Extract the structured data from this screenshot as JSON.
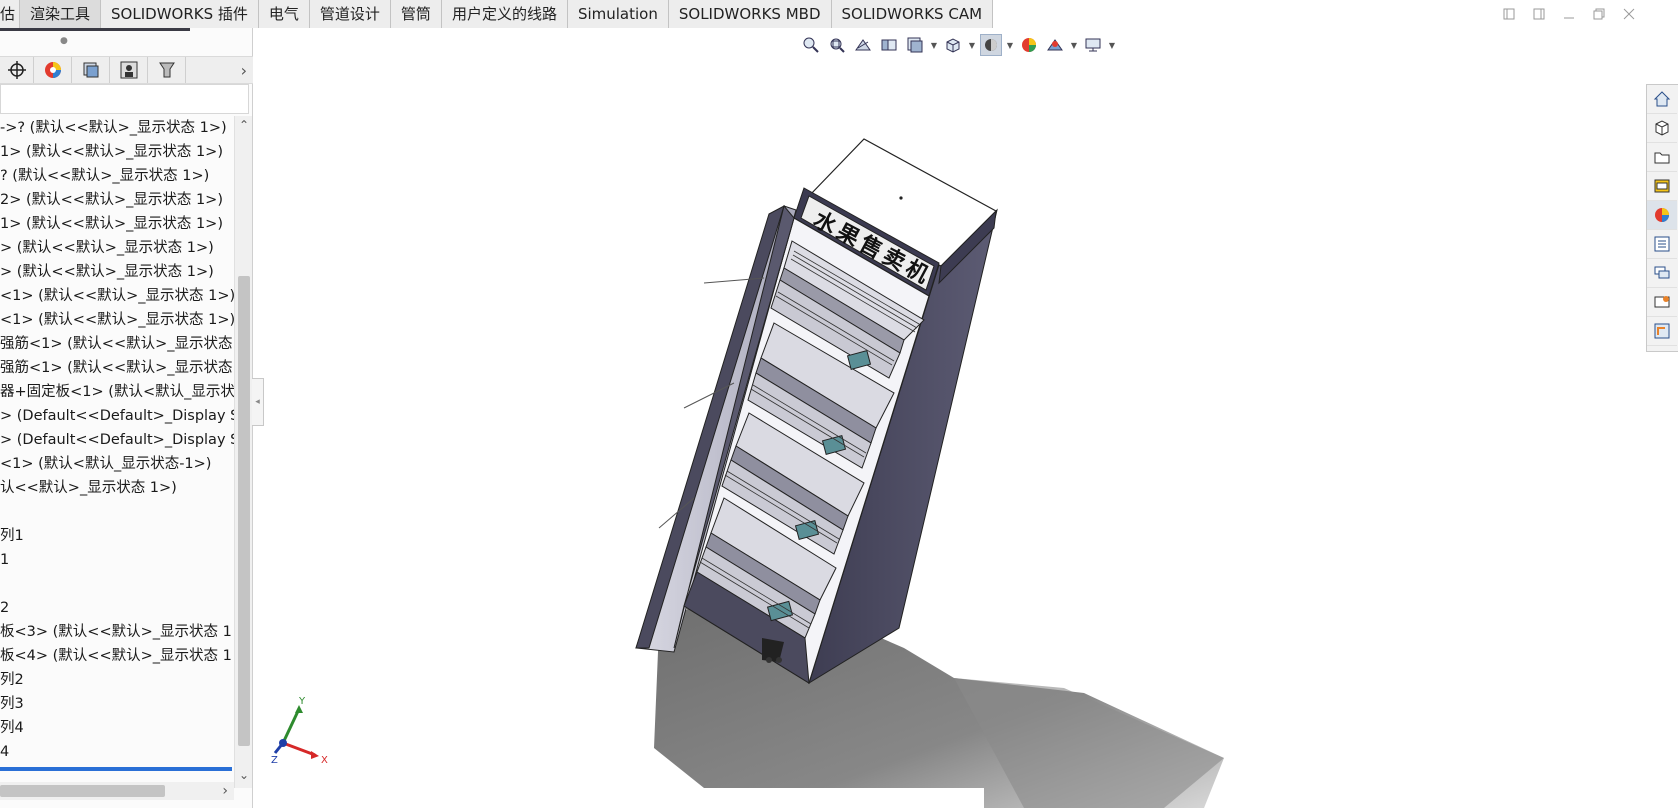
{
  "tabs": [
    {
      "label": "估",
      "active": false
    },
    {
      "label": "渲染工具",
      "active": true
    },
    {
      "label": "SOLIDWORKS 插件",
      "active": false
    },
    {
      "label": "电气",
      "active": false
    },
    {
      "label": "管道设计",
      "active": false
    },
    {
      "label": "管筒",
      "active": false
    },
    {
      "label": "用户定义的线路",
      "active": false
    },
    {
      "label": "Simulation",
      "active": false
    },
    {
      "label": "SOLIDWORKS MBD",
      "active": false
    },
    {
      "label": "SOLIDWORKS CAM",
      "active": false
    }
  ],
  "window_controls": [
    "restore-left-icon",
    "restore-right-icon",
    "minimize-icon",
    "maximize-icon",
    "close-icon"
  ],
  "panel_tabs": [
    "feature-manager-icon",
    "appearance-icon",
    "config-manager-icon",
    "dimxpert-icon",
    "display-manager-icon"
  ],
  "tree": {
    "rows": [
      "->? (默认<<默认>_显示状态 1>)",
      "1> (默认<<默认>_显示状态 1>)",
      "? (默认<<默认>_显示状态 1>)",
      "2> (默认<<默认>_显示状态 1>)",
      "1> (默认<<默认>_显示状态 1>)",
      "> (默认<<默认>_显示状态 1>)",
      "> (默认<<默认>_显示状态 1>)",
      "<1> (默认<<默认>_显示状态 1>)",
      "<1> (默认<<默认>_显示状态 1>)",
      "强筋<1> (默认<<默认>_显示状态",
      "强筋<1> (默认<<默认>_显示状态",
      "器+固定板<1> (默认<默认_显示状态",
      "> (Default<<Default>_Display St",
      "> (Default<<Default>_Display St",
      "<1> (默认<默认_显示状态-1>)",
      "认<<默认>_显示状态 1>)",
      "",
      "列1",
      "1",
      "",
      "2",
      "板<3> (默认<<默认>_显示状态 1",
      "板<4> (默认<<默认>_显示状态 1",
      "列2",
      "列3",
      "列4",
      "4"
    ]
  },
  "hud_icons": [
    "zoom-to-fit-icon",
    "zoom-to-area-icon",
    "previous-view-icon",
    "section-view-icon",
    "dynamic-annotation-icon",
    "view-orientation-icon",
    "display-style-icon",
    "hide-show-icon",
    "edit-appearance-icon",
    "apply-scene-icon",
    "view-settings-icon"
  ],
  "task_pane": [
    "home-icon",
    "3d-content-icon",
    "design-library-icon",
    "file-explorer-icon",
    "appearances-icon",
    "custom-properties-icon",
    "forum-icon",
    "solidworks-resources-icon",
    "routing-library-icon"
  ],
  "model": {
    "sign_text": "水果售卖机",
    "body_color": "#4b4a5e",
    "shadow_color": "#6f6f6f"
  },
  "triad": {
    "x_label": "X",
    "y_label": "Y",
    "z_label": "Z"
  }
}
